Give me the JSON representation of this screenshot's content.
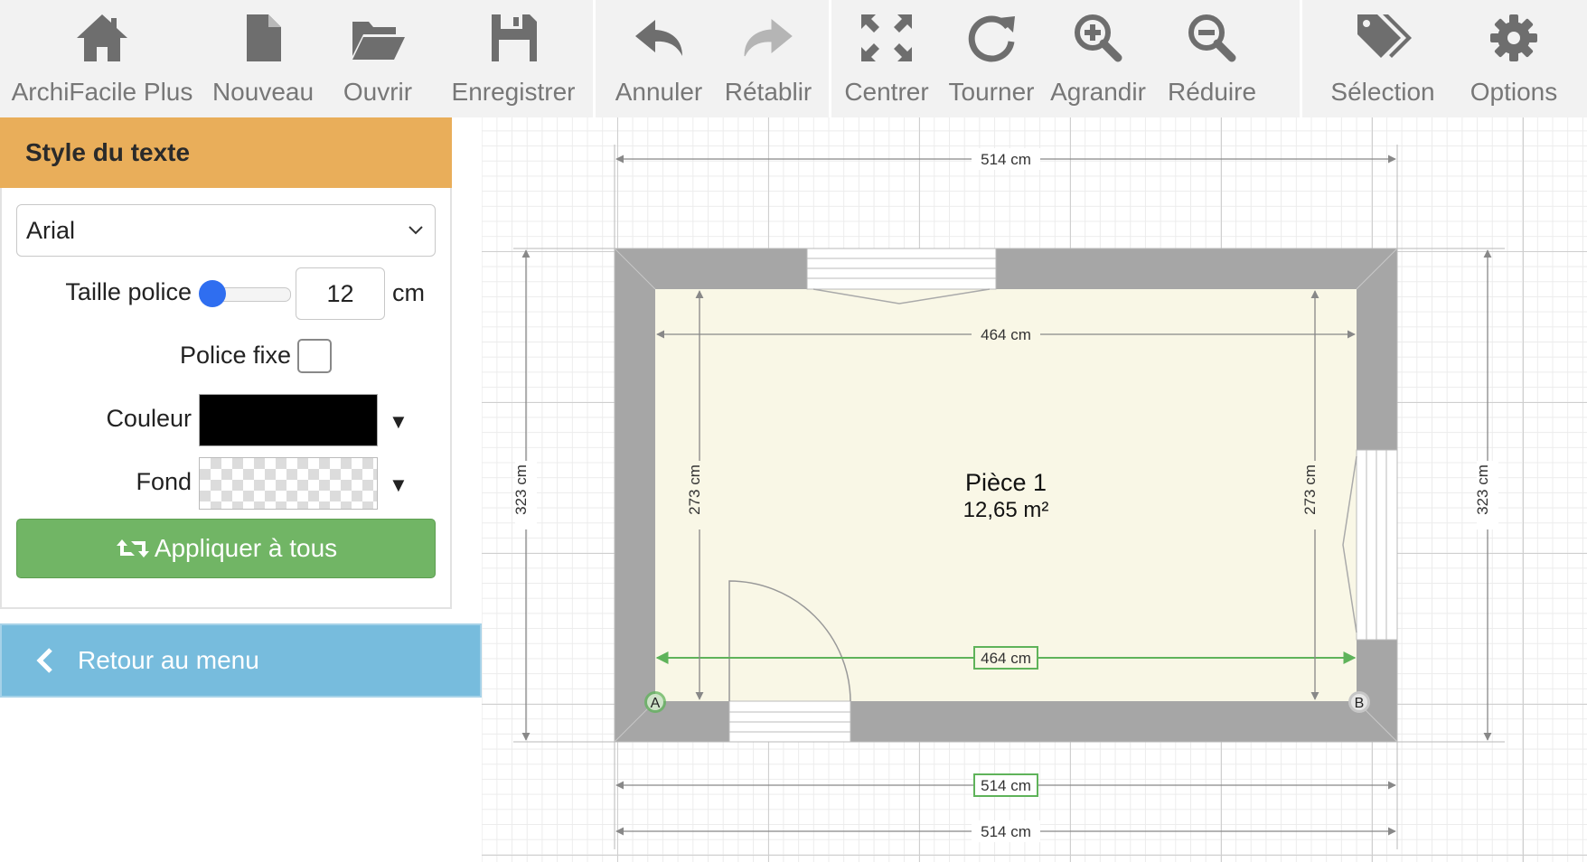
{
  "toolbar": {
    "groups": [
      [
        {
          "icon": "home-icon",
          "label": "ArchiFacile Plus"
        },
        {
          "icon": "new-file-icon",
          "label": "Nouveau"
        },
        {
          "icon": "open-folder-icon",
          "label": "Ouvrir"
        },
        {
          "icon": "save-icon",
          "label": "Enregistrer"
        }
      ],
      [
        {
          "icon": "undo-icon",
          "label": "Annuler"
        },
        {
          "icon": "redo-icon",
          "label": "Rétablir"
        }
      ],
      [
        {
          "icon": "center-icon",
          "label": "Centrer"
        },
        {
          "icon": "rotate-icon",
          "label": "Tourner"
        },
        {
          "icon": "zoom-in-icon",
          "label": "Agrandir"
        },
        {
          "icon": "zoom-out-icon",
          "label": "Réduire"
        }
      ],
      [
        {
          "icon": "tags-icon",
          "label": "Sélection"
        },
        {
          "icon": "gear-icon",
          "label": "Options"
        }
      ]
    ]
  },
  "panel": {
    "title": "Style du texte",
    "font_value": "Arial",
    "size_label": "Taille police",
    "size_value": "12",
    "size_unit": "cm",
    "fixed_label": "Police fixe",
    "fixed_checked": false,
    "color_label": "Couleur",
    "color_value": "#000000",
    "background_label": "Fond",
    "apply_label": "Appliquer à tous",
    "back_label": "Retour au menu"
  },
  "plan": {
    "room_name": "Pièce 1",
    "room_area": "12,65 m²",
    "dim_top_outer": "514 cm",
    "dim_top_inner": "464 cm",
    "dim_bottom_inner": "464 cm",
    "dim_bottom_outer_1": "514 cm",
    "dim_bottom_outer_2": "514 cm",
    "dim_left_outer": "323 cm",
    "dim_left_inner": "273 cm",
    "dim_right_inner": "273 cm",
    "dim_right_outer": "323 cm",
    "point_a": "A",
    "point_b": "B"
  },
  "colors": {
    "panel_header": "#e9ae5a",
    "apply_button": "#71b565",
    "back_button": "#77bcdd",
    "wall": "#a6a6a6",
    "floor": "#f9f7e6",
    "selected_dimension": "#5fb35a",
    "icon": "#6e6e6e"
  }
}
